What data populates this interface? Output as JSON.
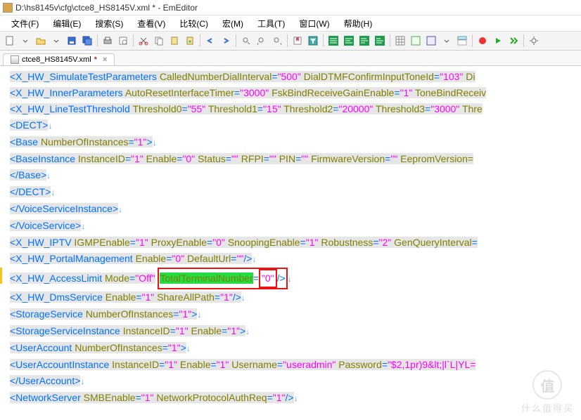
{
  "window": {
    "title": "D:\\hs8145v\\cfg\\ctce8_HS8145V.xml * - EmEditor"
  },
  "menu": {
    "file": "文件(F)",
    "edit": "编辑(E)",
    "search": "搜索(S)",
    "view": "查看(V)",
    "compare": "比较(C)",
    "macro": "宏(M)",
    "tools": "工具(T)",
    "window": "窗口(W)",
    "help": "帮助(H)"
  },
  "tab": {
    "name": "ctce8_HS8145V.xml",
    "mod": "*"
  },
  "watermark": {
    "title": "什么值得买"
  },
  "code": {
    "l1": {
      "e": "<X_HW_SimulateTestParameters",
      "a1": "CalledNumberDialInterval",
      "v1": "\"500\"",
      "a2": "DialDTMFConfirmInputToneId",
      "v2": "\"103\"",
      "a3": "Di"
    },
    "l2": {
      "e": "<X_HW_InnerParameters",
      "a1": "AutoResetInterfaceTimer",
      "v1": "\"3000\"",
      "a2": "FskBindReceiveGainEnable",
      "v2": "\"1\"",
      "a3": "ToneBindReceiv"
    },
    "l3": {
      "e": "<X_HW_LineTestThreshold",
      "a1": "Threshold0",
      "v1": "\"55\"",
      "a2": "Threshold1",
      "v2": "\"15\"",
      "a3": "Threshold2",
      "v3": "\"20000\"",
      "a4": "Threshold3",
      "v4": "\"3000\"",
      "tail": "Thre"
    },
    "l4": {
      "e": "<DECT",
      "c": ">"
    },
    "l5": {
      "e": "<Base",
      "a1": "NumberOfInstances",
      "v1": "\"1\"",
      "c": ">"
    },
    "l6": {
      "e": "<BaseInstance",
      "a1": "InstanceID",
      "v1": "\"1\"",
      "a2": "Enable",
      "v2": "\"0\"",
      "a3": "Status",
      "v3": "\"\"",
      "a4": "RFPI",
      "v4": "\"\"",
      "a5": "PIN",
      "v5": "\"\"",
      "a6": "FirmwareVersion",
      "v6": "\"\"",
      "a7": "EepromVersion="
    },
    "l7": {
      "e": "</Base",
      "c": ">"
    },
    "l8": {
      "e": "</DECT",
      "c": ">"
    },
    "l9": {
      "e": "</VoiceServiceInstance",
      "c": ">"
    },
    "l10": {
      "e": "</VoiceService",
      "c": ">"
    },
    "l11": {
      "e": "<X_HW_IPTV",
      "a1": "IGMPEnable",
      "v1": "\"1\"",
      "a2": "ProxyEnable",
      "v2": "\"0\"",
      "a3": "SnoopingEnable",
      "v3": "\"1\"",
      "a4": "Robustness",
      "v4": "\"2\"",
      "a5": "GenQueryInterval",
      "eqtail": "="
    },
    "l12": {
      "e": "<X_HW_PortalManagement",
      "a1": "Enable",
      "v1": "\"0\"",
      "a2": "DefaultUrl",
      "v2": "\"\"",
      "c": "/>"
    },
    "l13": {
      "e": "<X_HW_AccessLimit",
      "a1": "Mode",
      "v1": "\"Off\"",
      "a2": "TotalTerminalNumber",
      "eq2": "=",
      "v2": "\"0\"",
      "c": "/>"
    },
    "l14": {
      "e": "<X_HW_DmsService",
      "a1": "Enable",
      "v1": "\"1\"",
      "a2": "ShareAllPath",
      "v2": "\"1\"",
      "c": "/>"
    },
    "l15": {
      "e": "<StorageService",
      "a1": "NumberOfInstances",
      "v1": "\"1\"",
      "c": ">"
    },
    "l16": {
      "e": "<StorageServiceInstance",
      "a1": "InstanceID",
      "v1": "\"1\"",
      "a2": "Enable",
      "v2": "\"1\"",
      "c": ">"
    },
    "l17": {
      "e": "<UserAccount",
      "a1": "NumberOfInstances",
      "v1": "\"1\"",
      "c": ">"
    },
    "l18": {
      "e": "<UserAccountInstance",
      "a1": "InstanceID",
      "v1": "\"1\"",
      "a2": "Enable",
      "v2": "\"1\"",
      "a3": "Username",
      "v3": "\"useradmin\"",
      "a4": "Password",
      "v4": "\"$2,1pr)9&lt;|l`L|YL="
    },
    "l19": {
      "e": "</UserAccount",
      "c": ">"
    },
    "l20": {
      "e": "<NetworkServer",
      "a1": "SMBEnable",
      "v1": "\"1\"",
      "a2": "NetworkProtocolAuthReq",
      "v2": "\"1\"",
      "c": "/>"
    }
  }
}
